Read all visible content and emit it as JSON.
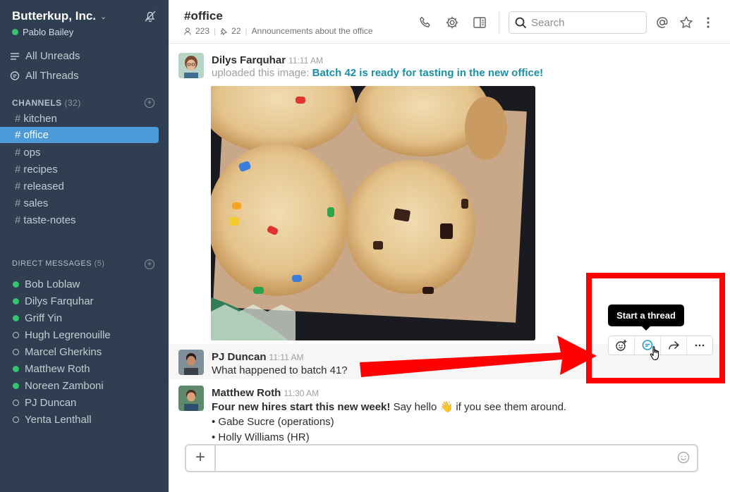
{
  "workspace": {
    "name": "Butterkup, Inc.",
    "current_user": "Pablo Bailey"
  },
  "sidebar": {
    "all_unreads": "All Unreads",
    "all_threads": "All Threads",
    "channels_title": "CHANNELS",
    "channels_count": "(32)",
    "channels": [
      {
        "name": "kitchen",
        "active": false
      },
      {
        "name": "office",
        "active": true
      },
      {
        "name": "ops",
        "active": false
      },
      {
        "name": "recipes",
        "active": false
      },
      {
        "name": "released",
        "active": false
      },
      {
        "name": "sales",
        "active": false
      },
      {
        "name": "taste-notes",
        "active": false
      }
    ],
    "dm_title": "DIRECT MESSAGES",
    "dm_count": "(5)",
    "direct_messages": [
      {
        "name": "Bob Loblaw",
        "online": true
      },
      {
        "name": "Dilys Farquhar",
        "online": true
      },
      {
        "name": "Griff Yin",
        "online": true
      },
      {
        "name": "Hugh Legrenouille",
        "online": false
      },
      {
        "name": "Marcel Gherkins",
        "online": false
      },
      {
        "name": "Matthew Roth",
        "online": true
      },
      {
        "name": "Noreen Zamboni",
        "online": true
      },
      {
        "name": "PJ Duncan",
        "online": false
      },
      {
        "name": "Yenta Lenthall",
        "online": false
      }
    ]
  },
  "header": {
    "channel": "#office",
    "members": "223",
    "pinned": "22",
    "topic": "Announcements about the office",
    "search_placeholder": "Search"
  },
  "messages": [
    {
      "sender": "Dilys Farquhar",
      "time": "11:11 AM",
      "prefix": "uploaded this image:",
      "link": "Batch 42 is ready for tasting in the new office!"
    },
    {
      "sender": "PJ Duncan",
      "time": "11:11 AM",
      "text": "What happened to batch 41?"
    },
    {
      "sender": "Matthew Roth",
      "time": "11:30 AM",
      "bold": "Four new hires start this new week!",
      "text_before_emoji": "Say hello",
      "emoji": "👋",
      "text_after_emoji": "if you see them around.",
      "bullets": [
        "• Gabe Sucre (operations)",
        "• Holly Williams (HR)"
      ]
    }
  ],
  "tooltip": "Start a thread",
  "composer": {
    "placeholder": ""
  },
  "colors": {
    "sidebar_bg": "#2f3f51",
    "active_channel": "#4c9ad8",
    "presence_online": "#38c16e",
    "link": "#1a8fa8",
    "highlight_annotation": "#ff0000"
  },
  "icons": [
    "bell-off-icon",
    "hamburger-icon",
    "threads-icon",
    "phone-icon",
    "gear-icon",
    "sidebar-panel-icon",
    "search-icon",
    "at-icon",
    "star-icon",
    "more-vertical-icon",
    "add-reaction-icon",
    "start-thread-icon",
    "share-icon",
    "more-horizontal-icon",
    "plus-icon",
    "emoji-icon",
    "hand-cursor-icon"
  ]
}
